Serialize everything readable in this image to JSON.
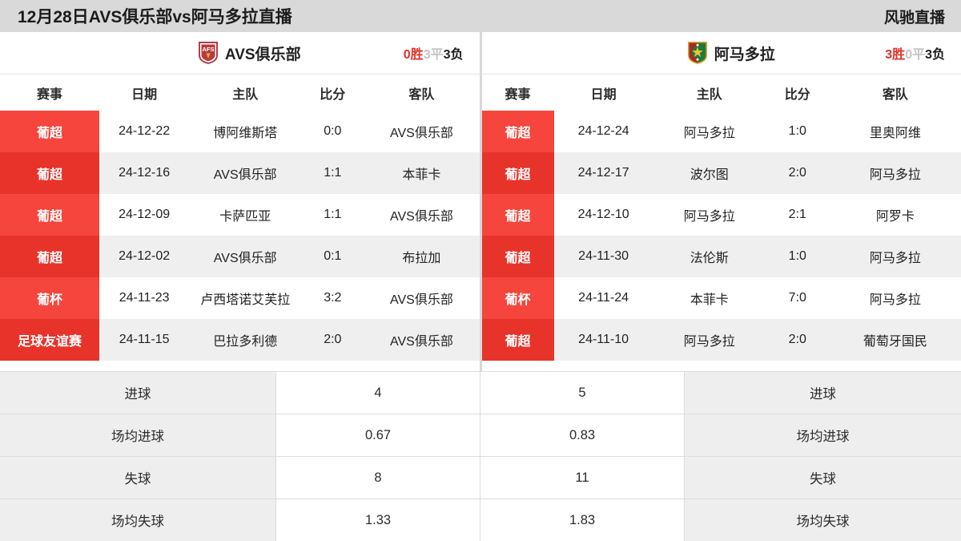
{
  "header": {
    "title": "12月28日AVS俱乐部vs阿马多拉直播",
    "brand": "风驰直播"
  },
  "left_panel": {
    "team": {
      "name": "AVS俱乐部",
      "crest": "avs-crest-icon",
      "record": {
        "wins": "0胜",
        "draws": "3平",
        "losses": "3负"
      }
    },
    "columns": [
      "赛事",
      "日期",
      "主队",
      "比分",
      "客队"
    ],
    "rows": [
      {
        "league": "葡超",
        "date": "24-12-22",
        "home": "博阿维斯塔",
        "score": "0:0",
        "away": "AVS俱乐部"
      },
      {
        "league": "葡超",
        "date": "24-12-16",
        "home": "AVS俱乐部",
        "score": "1:1",
        "away": "本菲卡"
      },
      {
        "league": "葡超",
        "date": "24-12-09",
        "home": "卡萨匹亚",
        "score": "1:1",
        "away": "AVS俱乐部"
      },
      {
        "league": "葡超",
        "date": "24-12-02",
        "home": "AVS俱乐部",
        "score": "0:1",
        "away": "布拉加"
      },
      {
        "league": "葡杯",
        "date": "24-11-23",
        "home": "卢西塔诺艾芙拉",
        "score": "3:2",
        "away": "AVS俱乐部"
      },
      {
        "league": "足球友谊赛",
        "date": "24-11-15",
        "home": "巴拉多利德",
        "score": "2:0",
        "away": "AVS俱乐部"
      }
    ]
  },
  "right_panel": {
    "team": {
      "name": "阿马多拉",
      "crest": "amadora-crest-icon",
      "record": {
        "wins": "3胜",
        "draws": "0平",
        "losses": "3负"
      }
    },
    "columns": [
      "赛事",
      "日期",
      "主队",
      "比分",
      "客队"
    ],
    "rows": [
      {
        "league": "葡超",
        "date": "24-12-24",
        "home": "阿马多拉",
        "score": "1:0",
        "away": "里奥阿维"
      },
      {
        "league": "葡超",
        "date": "24-12-17",
        "home": "波尔图",
        "score": "2:0",
        "away": "阿马多拉"
      },
      {
        "league": "葡超",
        "date": "24-12-10",
        "home": "阿马多拉",
        "score": "2:1",
        "away": "阿罗卡"
      },
      {
        "league": "葡超",
        "date": "24-11-30",
        "home": "法伦斯",
        "score": "1:0",
        "away": "阿马多拉"
      },
      {
        "league": "葡杯",
        "date": "24-11-24",
        "home": "本菲卡",
        "score": "7:0",
        "away": "阿马多拉"
      },
      {
        "league": "葡超",
        "date": "24-11-10",
        "home": "阿马多拉",
        "score": "2:0",
        "away": "葡萄牙国民"
      }
    ]
  },
  "stats": [
    {
      "label_left": "进球",
      "value_left": "4",
      "value_right": "5",
      "label_right": "进球"
    },
    {
      "label_left": "场均进球",
      "value_left": "0.67",
      "value_right": "0.83",
      "label_right": "场均进球"
    },
    {
      "label_left": "失球",
      "value_left": "8",
      "value_right": "11",
      "label_right": "失球"
    },
    {
      "label_left": "场均失球",
      "value_left": "1.33",
      "value_right": "1.83",
      "label_right": "场均失球"
    }
  ],
  "colors": {
    "league_badge": "#f5453c",
    "league_badge_alt": "#e8332b",
    "win_text": "#e03127",
    "draw_text": "#c4c4c4",
    "loss_text": "#1d1d1d",
    "page_bg": "#d9d9d9",
    "row_alt": "#efefef",
    "stat_label_bg": "#eeeeee"
  }
}
